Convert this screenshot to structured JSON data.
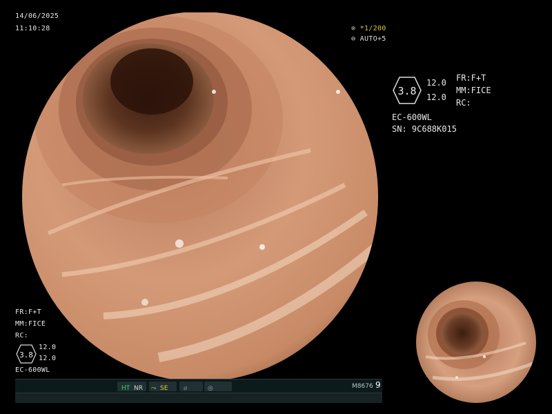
{
  "header": {
    "date": "14/06/2025",
    "time": "11:10:28"
  },
  "zoom": {
    "line1": "*1/200",
    "line2": "AUTO+5"
  },
  "info_panel": {
    "hex_value": "3.8",
    "value_top": "12.0",
    "value_bottom": "12.0",
    "fr": "FR:F+T",
    "mm": "MM:FICE",
    "rc": "RC:",
    "scope": "EC-600WL",
    "serial": "SN: 9C688K015"
  },
  "lower_left_panel": {
    "fr": "FR:F+T",
    "mm": "MM:FICE",
    "rc": "RC:",
    "hex_value": "3.8",
    "value_top": "12.0",
    "value_bottom": "12.0",
    "scope": "EC-600WL"
  },
  "status_bar": {
    "ht": "HT",
    "nr": "NR",
    "se": "SE",
    "code": "M8676",
    "page": "9",
    "colors": {
      "ht": "#3fd06a",
      "se": "#d8d040",
      "bg": "#0c1a1c"
    }
  },
  "icons": [
    "zoom-icon",
    "auto-icon",
    "se-icon",
    "freeze-icon",
    "capture-icon"
  ]
}
